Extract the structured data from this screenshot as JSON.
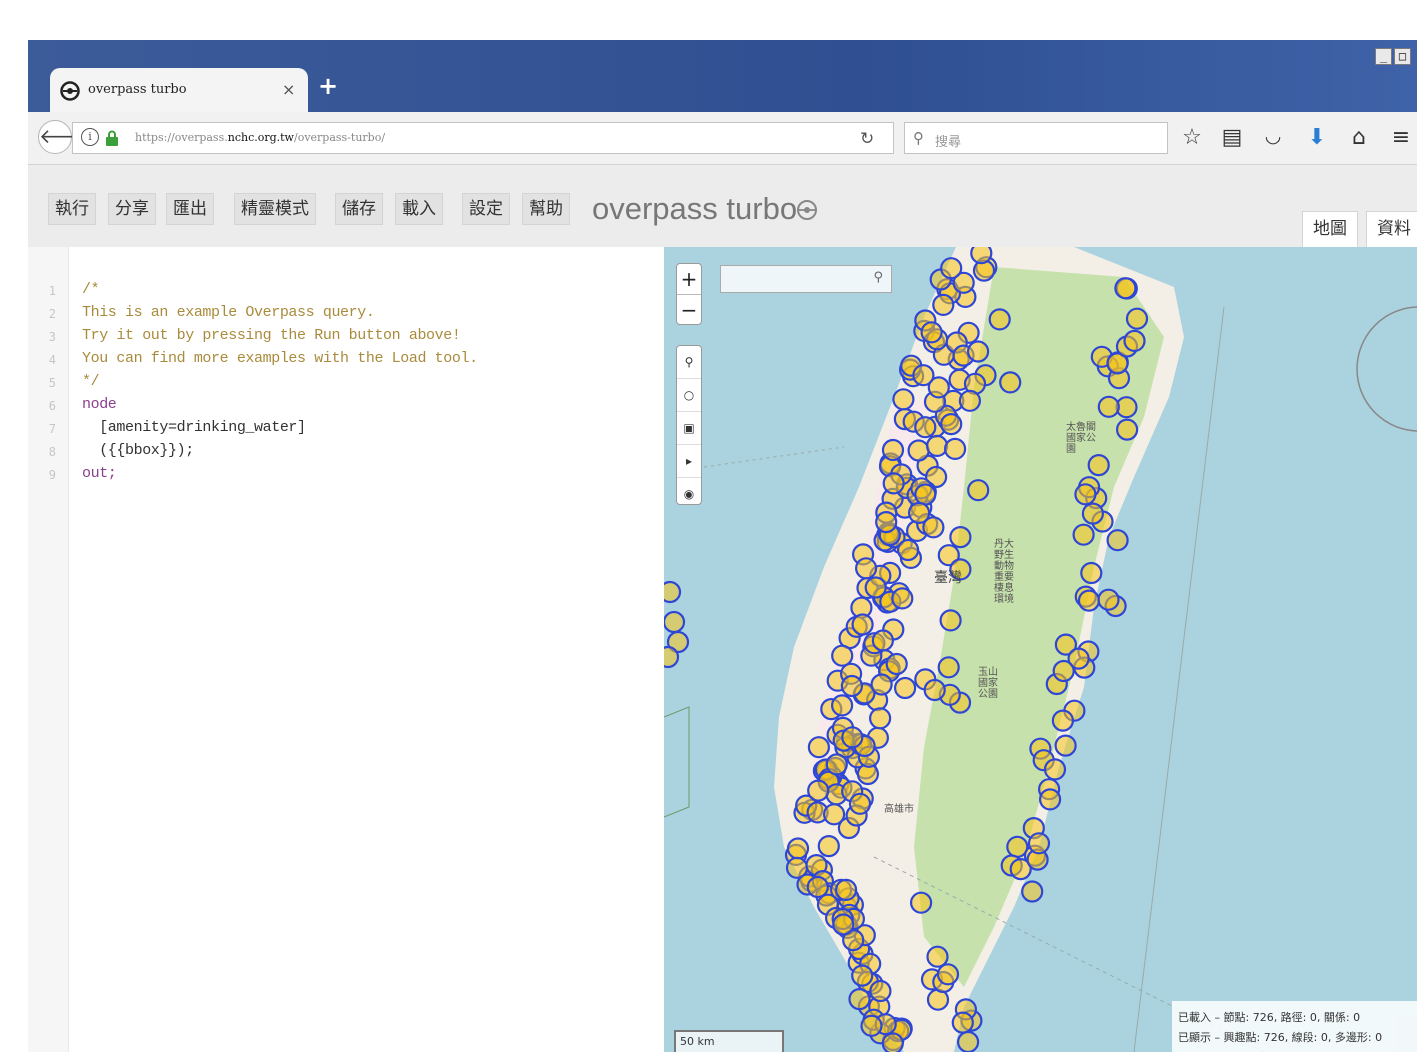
{
  "browser": {
    "tab_title": "overpass turbo",
    "tab_close": "×",
    "new_tab": "+",
    "url_prefix": "https://overpass.",
    "url_domain": "nchc.org.tw",
    "url_path": "/overpass-turbo/",
    "search_placeholder": "搜尋",
    "window_controls": [
      "_",
      "□"
    ],
    "toolbar_icons": [
      "star-icon",
      "reading-list-icon",
      "pocket-icon",
      "download-icon",
      "home-icon",
      "menu-icon"
    ]
  },
  "toolbar": {
    "buttons": [
      "執行",
      "分享",
      "匯出",
      "精靈模式",
      "儲存",
      "載入",
      "設定",
      "幫助"
    ],
    "title": "overpass turbo",
    "view_tabs": [
      "地圖",
      "資料"
    ]
  },
  "editor": {
    "line_numbers": [
      "1",
      "2",
      "3",
      "4",
      "5",
      "6",
      "7",
      "8",
      "9"
    ],
    "lines": [
      "/*",
      "This is an example Overpass query.",
      "Try it out by pressing the Run button above!",
      "You can find more examples with the Load tool.",
      "*/",
      "node",
      "  [amenity=drinking_water]",
      "  ({{bbox}});",
      "out;"
    ]
  },
  "map": {
    "zoom_in": "+",
    "zoom_out": "−",
    "scale": "50 km",
    "stats_line1": "已載入 – 節點: 726, 路徑: 0, 關係: 0",
    "stats_line2": "已顯示 – 興趣點: 726, 線段: 0, 多邊形: 0",
    "labels": {
      "taiwan": "臺灣",
      "national_park_1": "太魯閣國家公園",
      "national_park_2": "丹大野生動物重要棲息環境",
      "national_park_3": "玉山國家公園",
      "city": "高雄市"
    },
    "colors": {
      "sea": "#aad3df",
      "land": "#f3efe6",
      "park": "#c7e1ad",
      "marker_fill": "#f5c518",
      "marker_stroke": "#2e46d6"
    }
  }
}
